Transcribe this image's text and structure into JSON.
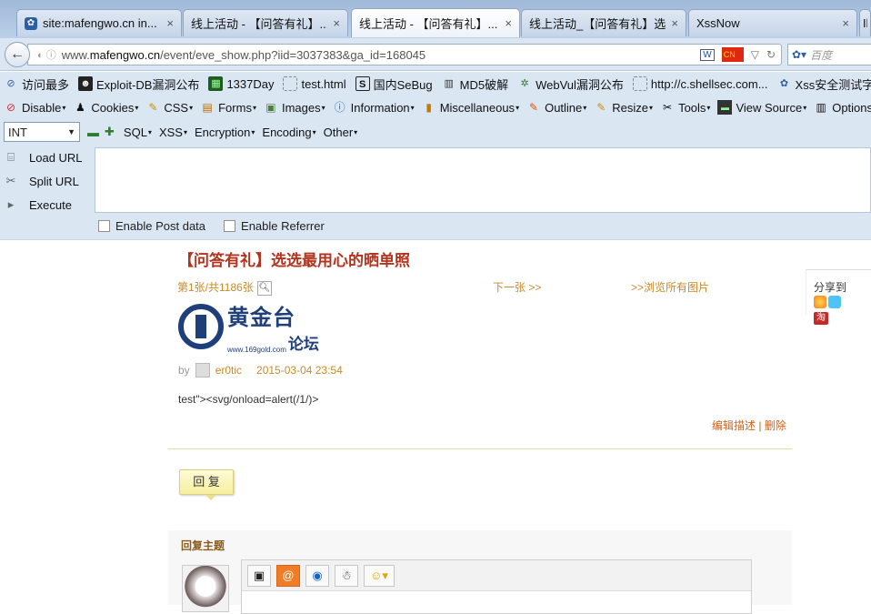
{
  "tabs": [
    {
      "title": "site:mafengwo.cn in...",
      "icon": "paw-icon"
    },
    {
      "title": "线上活动 - 【问答有礼】...",
      "icon": ""
    },
    {
      "title": "线上活动 - 【问答有礼】...",
      "icon": "",
      "active": true
    },
    {
      "title": "线上活动_【问答有礼】选...",
      "icon": ""
    },
    {
      "title": "XssNow",
      "icon": ""
    },
    {
      "title": "Il",
      "icon": ""
    }
  ],
  "tab_close": "×",
  "nav": {
    "url_prefix": "www.",
    "url_domain": "mafengwo.cn",
    "url_path": "/event/eve_show.php?iid=3037383&ga_id=168045",
    "search_placeholder": "百度",
    "reader_label": "W",
    "flag_label": "CN"
  },
  "bookmarks": [
    {
      "label": "访问最多",
      "icon": "compass-icon"
    },
    {
      "label": "Exploit-DB漏洞公布",
      "icon": "hacker-icon"
    },
    {
      "label": "1337Day",
      "icon": "1337-icon"
    },
    {
      "label": "test.html",
      "icon": "page-icon"
    },
    {
      "label": "国内SeBug",
      "icon": "sebug-icon"
    },
    {
      "label": "MD5破解",
      "icon": "grid-icon"
    },
    {
      "label": "WebVul漏洞公布",
      "icon": "bug-icon"
    },
    {
      "label": "http://c.shellsec.com...",
      "icon": "page-icon"
    },
    {
      "label": "Xss安全测试字符转换...",
      "icon": "paw-icon"
    }
  ],
  "webdev_toolbar": [
    {
      "label": "Disable",
      "icon": "no-icon"
    },
    {
      "label": "Cookies",
      "icon": "cookie-icon"
    },
    {
      "label": "CSS",
      "icon": "pencil-icon"
    },
    {
      "label": "Forms",
      "icon": "form-icon"
    },
    {
      "label": "Images",
      "icon": "image-icon"
    },
    {
      "label": "Information",
      "icon": "info-icon"
    },
    {
      "label": "Miscellaneous",
      "icon": "misc-icon"
    },
    {
      "label": "Outline",
      "icon": "outline-icon"
    },
    {
      "label": "Resize",
      "icon": "resize-icon"
    },
    {
      "label": "Tools",
      "icon": "tools-icon"
    },
    {
      "label": "View Source",
      "icon": "source-icon"
    },
    {
      "label": "Options",
      "icon": "options-icon"
    }
  ],
  "hackbar": {
    "type_select": "INT",
    "menus": [
      "SQL",
      "XSS",
      "Encryption",
      "Encoding",
      "Other"
    ],
    "load_url": "Load URL",
    "split_url": "Split URL",
    "execute": "Execute",
    "enable_post": "Enable Post data",
    "enable_referrer": "Enable Referrer"
  },
  "page": {
    "title": "【问答有礼】选选最用心的晒单照",
    "counter": "第1张/共1186张",
    "next": "下一张 >>",
    "browse_all": ">>浏览所有图片",
    "logo_main": "黄金台",
    "logo_url": "www.169gold.com",
    "logo_forum": "论坛",
    "by": "by",
    "author": "er0tic",
    "timestamp": "2015-03-04 23:54",
    "content": "test\"><svg/onload=alert(/1/)>",
    "edit_desc": "编辑描述",
    "delete": "删除",
    "separator": "|",
    "reply_button": "回 复",
    "reply_section_title": "回复主题",
    "share_label": "分享到",
    "taobao": "淘"
  }
}
